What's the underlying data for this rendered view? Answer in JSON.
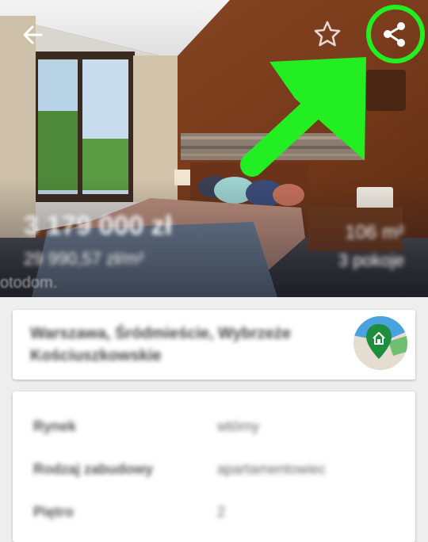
{
  "listing": {
    "price": "3 179 000 zł",
    "price_per_m2": "29 990,57 zł/m²",
    "area": "106 m²",
    "rooms": "3 pokoje",
    "watermark": "otodom."
  },
  "address": {
    "text": "Warszawa, Śródmieście, Wybrzeże Kościuszkowskie"
  },
  "details": [
    {
      "label": "Rynek",
      "value": "wtórny"
    },
    {
      "label": "Rodzaj zabudowy",
      "value": "apartamentowiec"
    },
    {
      "label": "Piętro",
      "value": "2"
    }
  ],
  "icons": {
    "back": "arrow-left-icon",
    "favorite": "star-outline-icon",
    "share": "share-icon",
    "map": "map-home-pin-icon"
  },
  "colors": {
    "annotation_green": "#22ee22",
    "map_pin": "#1e8e3e"
  }
}
